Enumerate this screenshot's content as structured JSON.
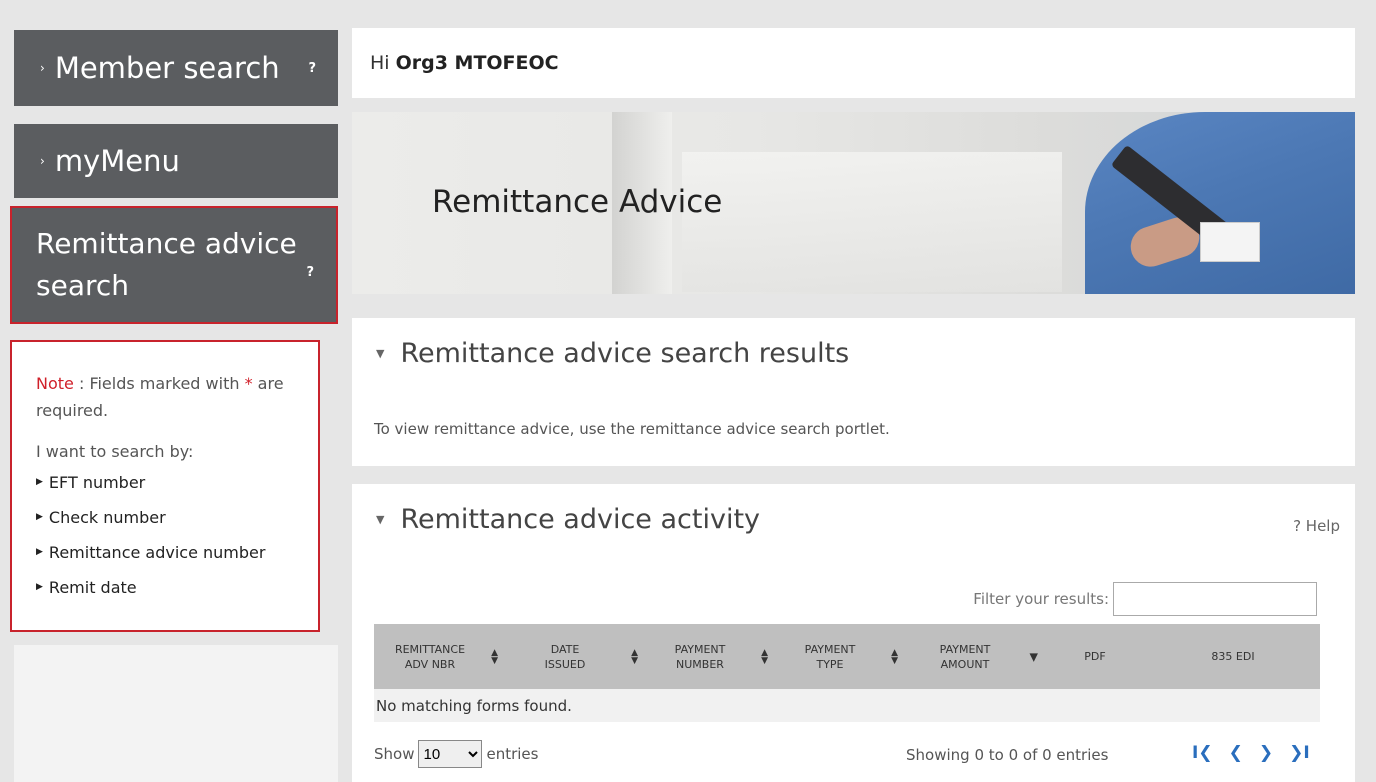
{
  "sidebar": {
    "member_search": "Member search",
    "my_menu": "myMenu",
    "remit_search_line1": "Remittance advice",
    "remit_search_line2": "search",
    "help_mark": "?",
    "caret": "›"
  },
  "note": {
    "label": "Note",
    "text_before": " : Fields marked with ",
    "asterisk": "*",
    "text_after": " are required.",
    "want": "I want to search by:",
    "options": [
      "EFT number",
      "Check number",
      "Remittance advice number",
      "Remit date"
    ]
  },
  "greeting": {
    "prefix": "Hi",
    "name": "Org3 MTOFEOC"
  },
  "banner": {
    "title": "Remittance Advice"
  },
  "results": {
    "title": "Remittance advice search results",
    "message": "To view remittance advice, use the remittance advice search portlet."
  },
  "activity": {
    "title": "Remittance advice activity",
    "help": "? Help",
    "filter_label": "Filter your results:",
    "filter_value": "",
    "columns": [
      {
        "line1": "Remittance",
        "line2": "Adv Nbr"
      },
      {
        "line1": "Date",
        "line2": "Issued"
      },
      {
        "line1": "Payment",
        "line2": "Number"
      },
      {
        "line1": "Payment",
        "line2": "Type"
      },
      {
        "line1": "Payment",
        "line2": "Amount"
      },
      {
        "line1": "PDF",
        "line2": ""
      },
      {
        "line1": "835 EDI",
        "line2": ""
      }
    ],
    "empty_message": "No matching forms found.",
    "show_label": "Show",
    "entries_value": "10",
    "entries_label": "entries",
    "showing": "Showing 0 to 0 of 0 entries",
    "pager": {
      "first": "I❮",
      "prev": "❮",
      "next": "❯",
      "last": "❯I"
    }
  },
  "colors": {
    "sidebar_button": "#5b5d60",
    "highlight_border": "#c8232c",
    "table_header": "#bfbfbf",
    "pager_link": "#2a6ebd"
  }
}
